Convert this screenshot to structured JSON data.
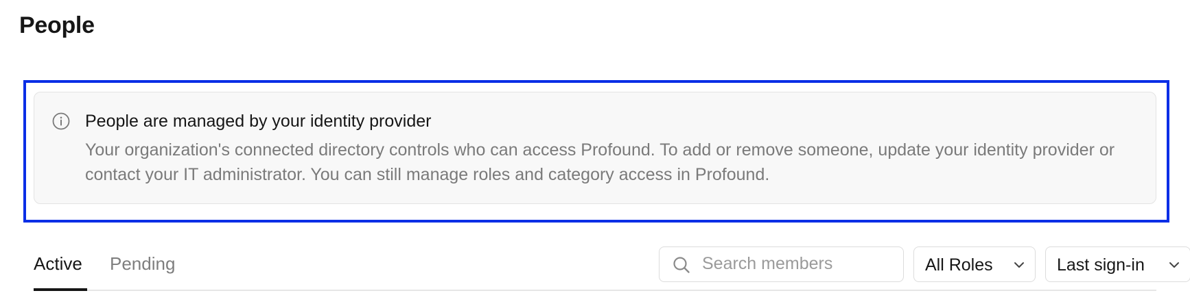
{
  "header": {
    "title": "People"
  },
  "notice": {
    "icon": "info-icon",
    "title": "People are managed by your identity provider",
    "body": "Your organization's connected directory controls who can access Profound. To add or remove someone, update your identity provider or contact your IT administrator. You can still manage roles and category access in Profound."
  },
  "tabs": [
    {
      "label": "Active",
      "selected": true
    },
    {
      "label": "Pending",
      "selected": false
    }
  ],
  "search": {
    "placeholder": "Search members",
    "value": "",
    "icon": "search-icon"
  },
  "filters": {
    "roles": {
      "selected": "All Roles",
      "icon": "chevron-down-icon"
    },
    "sort": {
      "selected": "Last sign-in",
      "icon": "chevron-down-icon"
    }
  },
  "colors": {
    "highlight": "#0a2ee6",
    "notice_bg": "#f8f8f8",
    "muted_text": "#7a7a7a",
    "active_tab": "#161616"
  }
}
